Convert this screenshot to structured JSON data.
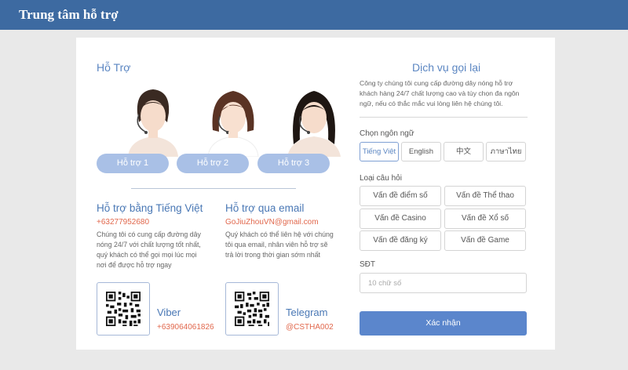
{
  "header": {
    "title": "Trung tâm hỗ trợ"
  },
  "support": {
    "title": "Hỗ Trợ",
    "agents": [
      {
        "label": "Hỗ trợ 1"
      },
      {
        "label": "Hỗ trợ 2"
      },
      {
        "label": "Hỗ trợ 3"
      }
    ]
  },
  "vietnamese": {
    "title": "Hỗ trợ bằng Tiếng Việt",
    "phone": "+63277952680",
    "description": "Chúng tôi có cung cấp đường dây nóng 24/7 với chất lượng tốt nhất, quý khách có thể gọi mọi lúc mọi nơi để được hỗ trợ ngay"
  },
  "email": {
    "title": "Hỗ trợ qua email",
    "address": "GoJiuZhouVN@gmail.com",
    "description": "Quý khách có thể liên hệ với chúng tôi qua email, nhân viên hỗ trợ sẽ trả lời trong thời gian sớm nhất"
  },
  "viber": {
    "name": "Viber",
    "number": "+639064061826"
  },
  "telegram": {
    "name": "Telegram",
    "handle": "@CSTHA002"
  },
  "callback": {
    "title": "Dịch vụ gọi lại",
    "description": "Công ty chúng tôi cung cấp đường dây nóng hỗ trợ khách hàng 24/7 chất lượng cao và tùy chọn đa ngôn ngữ, nếu có thắc mắc vui lòng liên hệ chúng tôi.",
    "language_label": "Chọn ngôn ngữ",
    "languages": [
      {
        "label": "Tiếng Việt",
        "active": true
      },
      {
        "label": "English",
        "active": false
      },
      {
        "label": "中文",
        "active": false
      },
      {
        "label": "ภาษาไทย",
        "active": false
      }
    ],
    "question_label": "Loại câu hỏi",
    "questions": [
      "Vấn đề điểm số",
      "Vấn đề Thể thao",
      "Vấn đề Casino",
      "Vấn đề Xổ số",
      "Vấn đề đăng ký",
      "Vấn đề Game"
    ],
    "phone_label": "SĐT",
    "phone_placeholder": "10 chữ số",
    "submit_label": "Xác nhận"
  },
  "colors": {
    "header": "#3d6aa1",
    "accent": "#5b86c2",
    "highlight": "#e1684d",
    "button": "#5b86cc",
    "agent_button": "#a9c0e6"
  }
}
